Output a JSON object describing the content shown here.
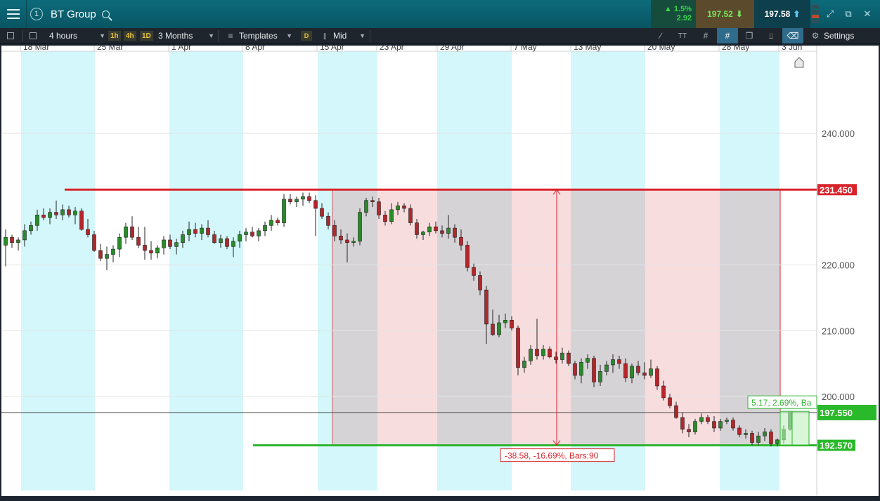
{
  "app": {
    "instrument": "BT Group",
    "info_badge": "1",
    "change_pct": "1.5%",
    "change_abs": "2.92",
    "sell_price": "197.52",
    "buy_price": "197.58"
  },
  "toolbar": {
    "interval": "4 hours",
    "tf_1h": "1h",
    "tf_4h": "4h",
    "tf_1d": "1D",
    "range": "3 Months",
    "templates": "Templates",
    "d_btn": "D",
    "price_type": "Mid",
    "settings": "Settings"
  },
  "colors": {
    "accent_teal": "#0b6676",
    "resistance": "#d9232b",
    "support": "#2fb52f",
    "up_candle": "#2a8a2a",
    "down_candle": "#b3262b",
    "weekend_band": "#d3f7fa"
  },
  "chart_data": {
    "type": "candlestick",
    "date_labels": [
      "18 Mar",
      "25 Mar",
      "1 Apr",
      "8 Apr",
      "15 Apr",
      "23 Apr",
      "29 Apr",
      "7 May",
      "13 May",
      "20 May",
      "28 May",
      "3 Jun"
    ],
    "y_ticks": [
      "240.000",
      "220.000",
      "210.000",
      "200.000"
    ],
    "y_range": [
      185.7,
      252.5
    ],
    "horizontal_lines": [
      {
        "name": "resistance",
        "price": 231.45,
        "label": "231.450"
      },
      {
        "name": "support",
        "price": 192.57,
        "label": "192.570"
      }
    ],
    "current_price": {
      "price": 197.55,
      "label": "197.550"
    },
    "measure_down": {
      "label": "-38.58, -16.69%, Bars:90",
      "from": 231.45,
      "to": 192.57
    },
    "measure_up": {
      "label": "5.17, 2.69%, Ba",
      "from": 192.57,
      "to": 197.74
    },
    "candles": [
      [
        223.0,
        225.4,
        219.8,
        224.2
      ],
      [
        224.2,
        224.6,
        222.6,
        223.4
      ],
      [
        223.4,
        224.2,
        222.2,
        223.8
      ],
      [
        223.8,
        226.2,
        222.8,
        225.2
      ],
      [
        225.2,
        226.6,
        224.6,
        226.0
      ],
      [
        226.0,
        228.4,
        225.2,
        227.6
      ],
      [
        227.6,
        228.6,
        226.8,
        227.2
      ],
      [
        227.2,
        228.6,
        226.2,
        228.0
      ],
      [
        228.0,
        229.8,
        227.0,
        227.6
      ],
      [
        227.6,
        229.2,
        226.8,
        228.4
      ],
      [
        228.4,
        229.0,
        227.2,
        227.6
      ],
      [
        227.6,
        228.8,
        226.2,
        228.2
      ],
      [
        228.2,
        228.6,
        225.2,
        225.4
      ],
      [
        225.4,
        227.0,
        224.2,
        224.6
      ],
      [
        224.6,
        225.2,
        222.0,
        222.2
      ],
      [
        222.2,
        223.2,
        220.6,
        221.0
      ],
      [
        221.0,
        222.8,
        219.2,
        221.6
      ],
      [
        221.6,
        223.0,
        220.4,
        222.4
      ],
      [
        222.4,
        224.8,
        221.2,
        224.2
      ],
      [
        224.2,
        226.4,
        223.2,
        225.8
      ],
      [
        225.8,
        227.4,
        223.8,
        224.2
      ],
      [
        224.2,
        225.8,
        222.6,
        223.0
      ],
      [
        223.0,
        225.8,
        220.8,
        222.2
      ],
      [
        222.2,
        223.6,
        220.8,
        221.8
      ],
      [
        221.8,
        223.0,
        221.0,
        222.6
      ],
      [
        222.6,
        224.4,
        221.6,
        223.8
      ],
      [
        223.8,
        224.6,
        222.4,
        222.8
      ],
      [
        222.8,
        224.0,
        221.6,
        223.4
      ],
      [
        223.4,
        225.2,
        222.6,
        224.6
      ],
      [
        224.6,
        226.6,
        223.6,
        225.4
      ],
      [
        225.4,
        226.4,
        224.2,
        224.8
      ],
      [
        224.8,
        226.2,
        223.8,
        225.6
      ],
      [
        225.6,
        226.8,
        224.2,
        224.6
      ],
      [
        224.6,
        225.2,
        223.2,
        223.4
      ],
      [
        223.4,
        224.6,
        222.6,
        224.0
      ],
      [
        224.0,
        224.4,
        222.4,
        222.8
      ],
      [
        222.8,
        224.2,
        221.2,
        223.6
      ],
      [
        223.6,
        225.2,
        222.6,
        224.6
      ],
      [
        224.6,
        225.6,
        223.6,
        225.0
      ],
      [
        225.0,
        225.8,
        224.2,
        224.4
      ],
      [
        224.4,
        225.6,
        223.6,
        225.2
      ],
      [
        225.2,
        226.6,
        224.4,
        226.0
      ],
      [
        226.0,
        227.6,
        225.2,
        226.8
      ],
      [
        226.8,
        227.2,
        226.0,
        226.4
      ],
      [
        226.4,
        230.8,
        225.8,
        230.0
      ],
      [
        230.0,
        230.8,
        229.2,
        229.6
      ],
      [
        229.6,
        230.4,
        228.8,
        230.0
      ],
      [
        230.0,
        231.0,
        229.0,
        230.4
      ],
      [
        230.4,
        231.0,
        229.4,
        229.8
      ],
      [
        229.8,
        230.6,
        224.4,
        228.6
      ],
      [
        228.6,
        229.4,
        227.0,
        227.4
      ],
      [
        227.4,
        228.0,
        225.4,
        226.0
      ],
      [
        226.0,
        226.8,
        223.6,
        224.4
      ],
      [
        224.4,
        225.4,
        223.2,
        223.8
      ],
      [
        223.8,
        224.8,
        220.4,
        223.4
      ],
      [
        223.4,
        224.2,
        222.8,
        223.6
      ],
      [
        223.6,
        228.6,
        223.0,
        228.0
      ],
      [
        228.0,
        230.2,
        227.4,
        229.8
      ],
      [
        229.8,
        230.4,
        228.8,
        229.6
      ],
      [
        229.6,
        230.2,
        227.0,
        227.6
      ],
      [
        227.6,
        228.2,
        226.0,
        226.6
      ],
      [
        226.6,
        229.4,
        226.2,
        228.4
      ],
      [
        228.4,
        229.6,
        227.6,
        229.0
      ],
      [
        229.0,
        229.4,
        228.0,
        228.6
      ],
      [
        228.6,
        229.2,
        226.0,
        226.4
      ],
      [
        226.4,
        227.0,
        224.0,
        224.6
      ],
      [
        224.6,
        225.2,
        223.8,
        225.0
      ],
      [
        225.0,
        226.4,
        224.4,
        225.8
      ],
      [
        225.8,
        226.6,
        224.8,
        225.2
      ],
      [
        225.2,
        226.0,
        224.2,
        224.8
      ],
      [
        224.8,
        227.6,
        224.0,
        225.6
      ],
      [
        225.6,
        226.2,
        223.4,
        224.2
      ],
      [
        224.2,
        225.4,
        222.2,
        223.0
      ],
      [
        223.0,
        223.6,
        219.0,
        219.6
      ],
      [
        219.6,
        220.2,
        217.6,
        218.4
      ],
      [
        218.4,
        219.0,
        215.4,
        216.2
      ],
      [
        216.2,
        216.8,
        208.0,
        211.0
      ],
      [
        211.0,
        213.2,
        209.2,
        209.4
      ],
      [
        209.4,
        212.4,
        209.0,
        211.2
      ],
      [
        211.2,
        212.6,
        210.4,
        211.6
      ],
      [
        211.6,
        212.2,
        210.0,
        210.4
      ],
      [
        210.4,
        210.8,
        203.2,
        204.4
      ],
      [
        204.4,
        206.0,
        203.6,
        205.4
      ],
      [
        205.4,
        207.8,
        204.8,
        207.2
      ],
      [
        207.2,
        211.8,
        205.6,
        206.2
      ],
      [
        206.2,
        207.8,
        205.6,
        207.2
      ],
      [
        207.2,
        207.6,
        205.8,
        206.0
      ],
      [
        206.0,
        206.8,
        205.0,
        205.6
      ],
      [
        205.6,
        207.4,
        205.0,
        206.6
      ],
      [
        206.6,
        207.0,
        204.6,
        205.0
      ],
      [
        205.0,
        205.4,
        202.6,
        203.2
      ],
      [
        203.2,
        205.8,
        202.0,
        205.2
      ],
      [
        205.2,
        206.4,
        204.2,
        205.8
      ],
      [
        205.8,
        206.2,
        201.4,
        202.2
      ],
      [
        202.2,
        204.8,
        201.6,
        203.8
      ],
      [
        203.8,
        205.4,
        203.2,
        204.8
      ],
      [
        204.8,
        206.4,
        203.6,
        205.6
      ],
      [
        205.6,
        206.2,
        204.2,
        205.0
      ],
      [
        205.0,
        205.8,
        202.2,
        202.8
      ],
      [
        202.8,
        205.0,
        202.0,
        204.6
      ],
      [
        204.6,
        205.4,
        203.2,
        203.6
      ],
      [
        203.6,
        205.2,
        202.6,
        203.2
      ],
      [
        203.2,
        205.6,
        202.8,
        204.2
      ],
      [
        204.2,
        204.6,
        201.0,
        201.6
      ],
      [
        201.6,
        202.4,
        199.4,
        199.8
      ],
      [
        199.8,
        200.4,
        198.2,
        198.6
      ],
      [
        198.6,
        199.2,
        196.6,
        196.8
      ],
      [
        196.8,
        197.6,
        194.4,
        195.0
      ],
      [
        195.0,
        195.8,
        193.8,
        194.6
      ],
      [
        194.6,
        196.6,
        194.2,
        196.2
      ],
      [
        196.2,
        197.4,
        195.8,
        196.8
      ],
      [
        196.8,
        197.2,
        195.8,
        196.2
      ],
      [
        196.2,
        197.0,
        194.6,
        195.2
      ],
      [
        195.2,
        196.6,
        194.8,
        196.2
      ],
      [
        196.2,
        196.8,
        195.8,
        196.4
      ],
      [
        196.4,
        196.8,
        194.8,
        195.2
      ],
      [
        195.2,
        195.6,
        193.8,
        194.2
      ],
      [
        194.2,
        195.0,
        193.6,
        194.4
      ],
      [
        194.4,
        194.8,
        192.6,
        193.0
      ],
      [
        193.0,
        194.6,
        192.6,
        194.0
      ],
      [
        194.0,
        195.2,
        193.2,
        194.6
      ],
      [
        194.6,
        195.0,
        192.4,
        192.8
      ],
      [
        192.8,
        193.6,
        192.4,
        193.4
      ],
      [
        193.4,
        195.6,
        192.8,
        195.0
      ],
      [
        195.0,
        197.8,
        194.8,
        197.6
      ]
    ]
  }
}
